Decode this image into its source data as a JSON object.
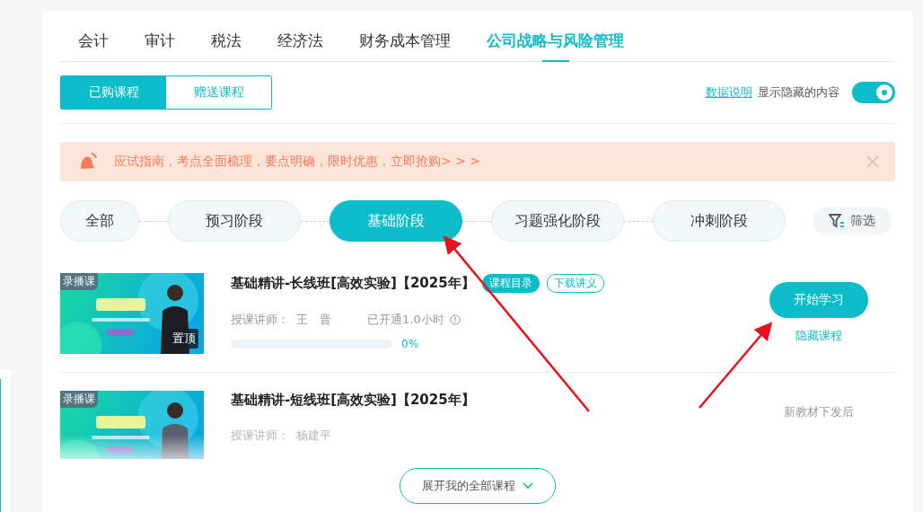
{
  "subject_tabs": [
    {
      "label": "会计",
      "selected": false
    },
    {
      "label": "审计",
      "selected": false
    },
    {
      "label": "税法",
      "selected": false
    },
    {
      "label": "经济法",
      "selected": false
    },
    {
      "label": "财务成本管理",
      "selected": false
    },
    {
      "label": "公司战略与风险管理",
      "selected": true
    }
  ],
  "purchase_tabs": [
    {
      "label": "已购课程",
      "selected": true
    },
    {
      "label": "赠送课程",
      "selected": false
    }
  ],
  "data_link": "数据说明",
  "show_hidden": {
    "label": "显示隐藏的内容",
    "on": true
  },
  "notice": {
    "text": "应试指南，考点全面梳理，要点明确，限时优惠，立即抢购> > >"
  },
  "stages": [
    {
      "label": "全部",
      "selected": false
    },
    {
      "label": "预习阶段",
      "selected": false
    },
    {
      "label": "基础阶段",
      "selected": true
    },
    {
      "label": "习题强化阶段",
      "selected": false
    },
    {
      "label": "冲刺阶段",
      "selected": false
    }
  ],
  "filter_button": "筛选",
  "courses": [
    {
      "badge": "录播课",
      "pinned": true,
      "pinned_label": "置顶",
      "title": "基础精讲-长线班[高效实验]【2025年】",
      "tags": [
        {
          "label": "课程目录",
          "kind": "filled"
        },
        {
          "label": "下载讲义",
          "kind": "outline"
        }
      ],
      "teacher_label": "授课讲师：",
      "teacher": "王　晋",
      "hours": "已开通1.0小时",
      "level": 0,
      "progress_text": "0%",
      "action": {
        "kind": "button",
        "label": "开始学习"
      },
      "hide_link": "隐藏课程"
    },
    {
      "badge": "录播课",
      "pinned": false,
      "title": "基础精讲-短线班[高效实验]【2025年】",
      "teacher_label": "授课讲师：",
      "teacher": "杨建平",
      "action": {
        "kind": "note",
        "label": "新教材下发后"
      }
    }
  ],
  "expand_button": "展开我的全部课程"
}
